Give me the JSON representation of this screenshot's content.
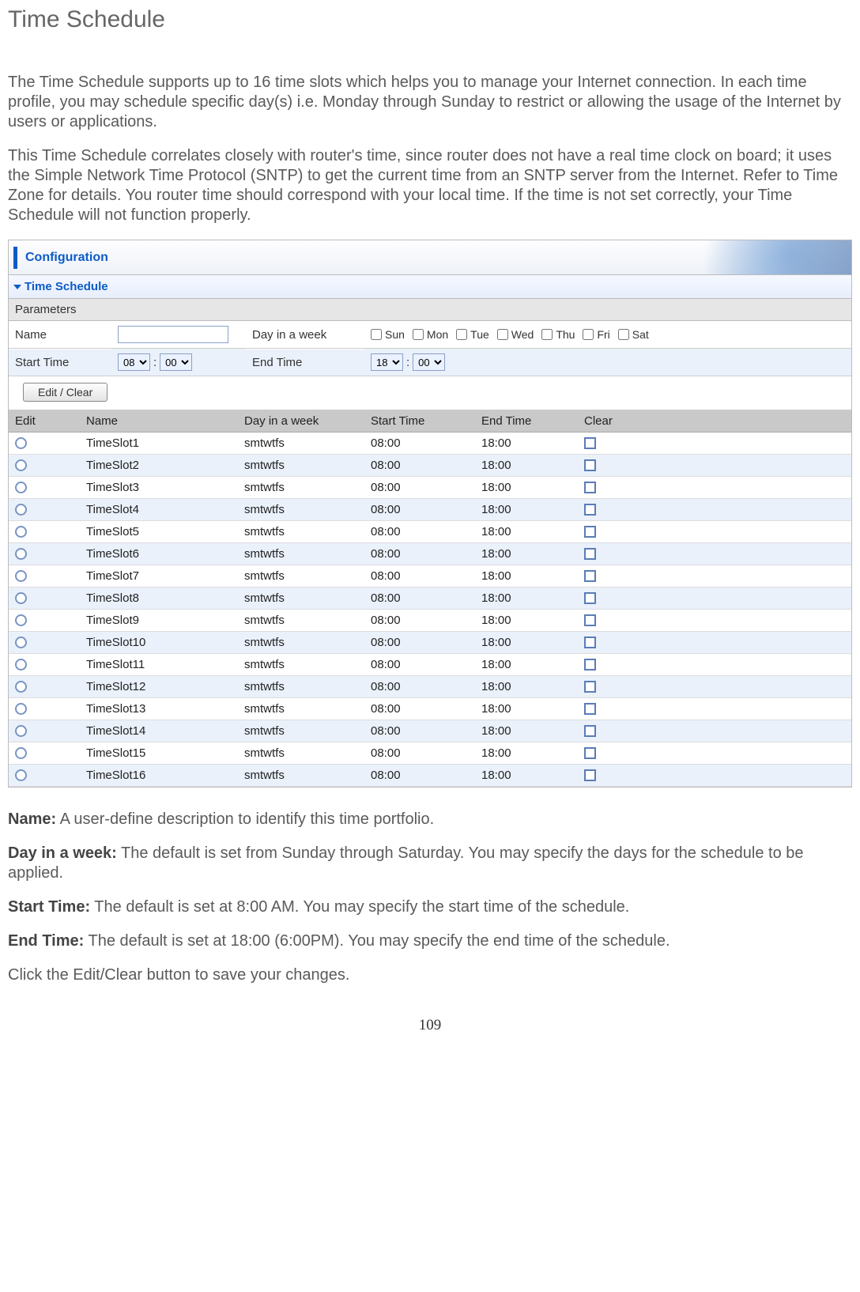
{
  "page_title": "Time Schedule",
  "intro": [
    "The Time Schedule supports up to 16 time slots which helps you to manage your Internet connection. In each time profile, you may schedule specific day(s) i.e. Monday through Sunday to restrict or allowing the usage of the Internet by users or applications.",
    "This Time Schedule correlates closely with router's time, since router does not have a real time clock on board; it uses the Simple Network Time Protocol (SNTP) to get the current time from an SNTP server from the Internet. Refer to Time Zone for details.  You router time should correspond with your local time.  If the time is not set correctly, your Time Schedule will not function properly."
  ],
  "panel": {
    "header": "Configuration",
    "section": "Time Schedule",
    "params_label": "Parameters",
    "labels": {
      "name": "Name",
      "day": "Day in a week",
      "start": "Start Time",
      "end": "End Time"
    },
    "days": [
      "Sun",
      "Mon",
      "Tue",
      "Wed",
      "Thu",
      "Fri",
      "Sat"
    ],
    "start_hour": "08",
    "start_min": "00",
    "end_hour": "18",
    "end_min": "00",
    "button": "Edit / Clear",
    "table_headers": [
      "Edit",
      "Name",
      "Day in a week",
      "Start Time",
      "End Time",
      "Clear"
    ],
    "rows": [
      {
        "name": "TimeSlot1",
        "day": "smtwtfs",
        "start": "08:00",
        "end": "18:00"
      },
      {
        "name": "TimeSlot2",
        "day": "smtwtfs",
        "start": "08:00",
        "end": "18:00"
      },
      {
        "name": "TimeSlot3",
        "day": "smtwtfs",
        "start": "08:00",
        "end": "18:00"
      },
      {
        "name": "TimeSlot4",
        "day": "smtwtfs",
        "start": "08:00",
        "end": "18:00"
      },
      {
        "name": "TimeSlot5",
        "day": "smtwtfs",
        "start": "08:00",
        "end": "18:00"
      },
      {
        "name": "TimeSlot6",
        "day": "smtwtfs",
        "start": "08:00",
        "end": "18:00"
      },
      {
        "name": "TimeSlot7",
        "day": "smtwtfs",
        "start": "08:00",
        "end": "18:00"
      },
      {
        "name": "TimeSlot8",
        "day": "smtwtfs",
        "start": "08:00",
        "end": "18:00"
      },
      {
        "name": "TimeSlot9",
        "day": "smtwtfs",
        "start": "08:00",
        "end": "18:00"
      },
      {
        "name": "TimeSlot10",
        "day": "smtwtfs",
        "start": "08:00",
        "end": "18:00"
      },
      {
        "name": "TimeSlot11",
        "day": "smtwtfs",
        "start": "08:00",
        "end": "18:00"
      },
      {
        "name": "TimeSlot12",
        "day": "smtwtfs",
        "start": "08:00",
        "end": "18:00"
      },
      {
        "name": "TimeSlot13",
        "day": "smtwtfs",
        "start": "08:00",
        "end": "18:00"
      },
      {
        "name": "TimeSlot14",
        "day": "smtwtfs",
        "start": "08:00",
        "end": "18:00"
      },
      {
        "name": "TimeSlot15",
        "day": "smtwtfs",
        "start": "08:00",
        "end": "18:00"
      },
      {
        "name": "TimeSlot16",
        "day": "smtwtfs",
        "start": "08:00",
        "end": "18:00"
      }
    ]
  },
  "outro": [
    {
      "bold": "Name:",
      "text": " A user-define description to identify this time portfolio."
    },
    {
      "bold": "Day in a week:",
      "text": " The default is set from Sunday through Saturday. You may specify the days for the schedule to be applied."
    },
    {
      "bold": "Start Time:",
      "text": " The default is set at 8:00 AM.  You may specify the start time of the schedule."
    },
    {
      "bold": "End Time:",
      "text": " The default is set at 18:00 (6:00PM). You may specify the end time of the schedule."
    },
    {
      "bold": "",
      "text": "Click the Edit/Clear button to save your changes."
    }
  ],
  "page_number": "109"
}
